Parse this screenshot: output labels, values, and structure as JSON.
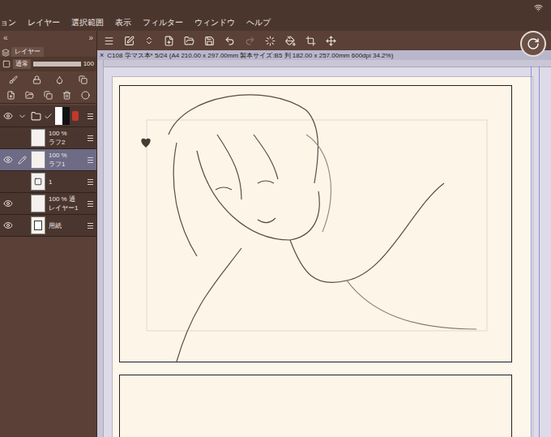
{
  "status": {
    "wifi": true
  },
  "menu": [
    "ョン",
    "レイヤー",
    "選択範囲",
    "表示",
    "フィルター",
    "ウィンドウ",
    "ヘルプ"
  ],
  "panel": {
    "collapse_left": "«",
    "collapse_right": "»",
    "tab": "レイヤー",
    "blend_mode": "通常",
    "opacity": "100"
  },
  "layers": [
    {
      "kind": "folder",
      "visible": true,
      "selected": false,
      "expanded": true,
      "editing": false,
      "opacity": "",
      "name": ""
    },
    {
      "kind": "raster",
      "visible": false,
      "selected": false,
      "expanded": false,
      "editing": false,
      "opacity": "100 %",
      "name": "ラフ2"
    },
    {
      "kind": "raster",
      "visible": true,
      "selected": true,
      "expanded": false,
      "editing": true,
      "opacity": "100 %",
      "name": "ラフ1"
    },
    {
      "kind": "frame",
      "visible": false,
      "selected": false,
      "expanded": false,
      "editing": false,
      "opacity": "",
      "name": "1"
    },
    {
      "kind": "raster",
      "visible": true,
      "selected": false,
      "expanded": false,
      "editing": false,
      "opacity": "100 % 通",
      "name": "レイヤー1"
    },
    {
      "kind": "paper",
      "visible": true,
      "selected": false,
      "expanded": false,
      "editing": false,
      "opacity": "",
      "name": "用紙"
    }
  ],
  "document": {
    "close": "×",
    "title": "C108 学マス本* 5/24 (A4 210.00 x 297.00mm 製本サイズ:B5 判 182.00 x 257.00mm 600dpi 34.2%)"
  }
}
